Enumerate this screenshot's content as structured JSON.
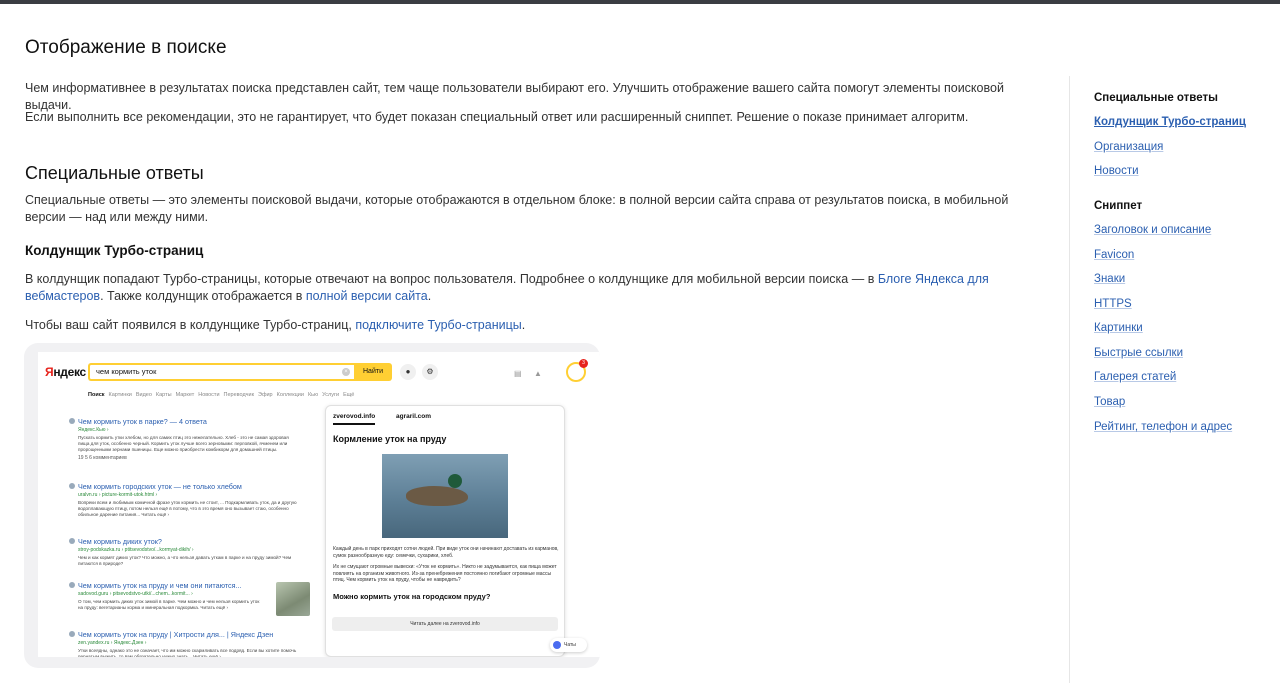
{
  "page": {
    "title": "Отображение в поиске",
    "intro_1": "Чем информативнее в результатах поиска представлен сайт, тем чаще пользователи выбирают его. Улучшить отображение вашего сайта помогут элементы поисковой выдачи.",
    "intro_2": "Если выполнить все рекомендации, это не гарантирует, что будет показан специальный ответ или расширенный сниппет. Решение о показе принимает алгоритм.",
    "section_title": "Специальные ответы",
    "section_text": "Специальные ответы — это элементы поисковой выдачи, которые отображаются в отдельном блоке: в полной версии сайта справа от результатов поиска, в мобильной версии — над или между ними.",
    "subsection_title": "Колдунщик Турбо-страниц",
    "para_1_pre": "В колдунщик попадают Турбо-страницы, которые отвечают на вопрос пользователя. Подробнее о колдунщике для мобильной версии поиска — в ",
    "para_1_link": "Блоге Яндекса для вебмастеров",
    "para_1_mid": ". Также колдунщик отображается в ",
    "para_1_link2": "полной версии сайта",
    "para_1_end": ".",
    "para_2_pre": "Чтобы ваш сайт появился в колдунщике Турбо-страниц, ",
    "para_2_link": "подключите Турбо-страницы",
    "para_2_end": "."
  },
  "toc": {
    "group_1_title": "Специальные ответы",
    "group_1_items": [
      "Колдунщик Турбо-страниц",
      "Организация",
      "Новости"
    ],
    "group_2_title": "Сниппет",
    "group_2_items": [
      "Заголовок и описание",
      "Favicon",
      "Знаки",
      "HTTPS",
      "Картинки",
      "Быстрые ссылки",
      "Галерея статей",
      "Товар",
      "Рейтинг, телефон и адрес"
    ]
  },
  "serp": {
    "logo": "Яндекс",
    "query": "чем кормить уток",
    "search_button": "Найти",
    "tabs": [
      "Поиск",
      "Картинки",
      "Видео",
      "Карты",
      "Маркет",
      "Новости",
      "Переводчик",
      "Эфир",
      "Коллекции",
      "Кью",
      "Услуги",
      "Ещё"
    ],
    "avatar_badge": "3",
    "results": [
      {
        "title": "Чем кормить уток в парке? — 4 ответа",
        "url": "Яндекс.Кью ›",
        "snippet": "Пускать кормить утки хлебом, но для самих птиц это нежелательно. Хлеб - это не самая здоровая пища для уток, особенно черный. Кормить уток лучше всего зерновыми: перловкой, ячменем или пророщенными зернами пшеницы. Еще можно приобрести комбикорм для домашней птицы.",
        "meta": "19  5  6 комментариев"
      },
      {
        "title": "Чем кормить городских уток — не только хлебом",
        "url": "uralvn.ru › picture-kormit-utok.html ›",
        "snippet": "Вопреки всем и любимым комичной фразе уток кормить не стоит, ... Подкармливать уток, да и другую водоплавающую птицу, потом нельзя ещё в потому, что в это время оно вызывает стаю, особенно обильное дарение питания... Читать ещё ›"
      },
      {
        "title": "Чем кормить диких уток?",
        "url": "stroy-podskazka.ru › ptitsevodstvo/...kormyat-dikih/ ›",
        "snippet": "Чем и как кормят диких уток? Что можно, а что нельзя давать уткам в парке и на пруду зимой? Чем питаются в природе?"
      },
      {
        "title": "Чем кормить уток на пруду и чем они питаются...",
        "url": "sadovod.guru › pitsevodstvo-utki/...chem...kormit... ›",
        "snippet": "О том, чем кормить диких уток зимой в парке. Чем можно и чем нельзя кормить уток на пруду: вегетарианы корма и минеральная подкормка. Читать ещё ›"
      },
      {
        "title": "Чем кормить уток на пруду | Хитрости для... | Яндекс Дзен",
        "url": "zen.yandex.ru › Яндекс.Дзен ›",
        "snippet": "Утки всеядны, однако это не означает, что им можно скармливать все подряд. Если вы хотите помочь пернатым выжить, то вам обязательно нужно знать... Читать ещё ›"
      }
    ],
    "card": {
      "site_1": "zverovod.info",
      "site_2": "agraril.com",
      "title": "Кормление уток на пруду",
      "text_1": "Каждый день в парк приходят сотни людей. При виде уток они начинают доставать из карманов, сумок разнообразную еду: семечки, сухарики, хлеб.",
      "text_2": "Их не смущают огромные вывески: «Уток не кормить». Никто не задумывается, как пища может повлиять на организм животного. Из-за пренебрежения постоянно погибают огромные массы птиц. Чем кормить уток на пруду, чтобы не навредить?",
      "subtitle": "Можно кормить уток на городском пруду?",
      "read_more": "Читать далее на zverovod.info"
    },
    "chats": "Чаты"
  }
}
